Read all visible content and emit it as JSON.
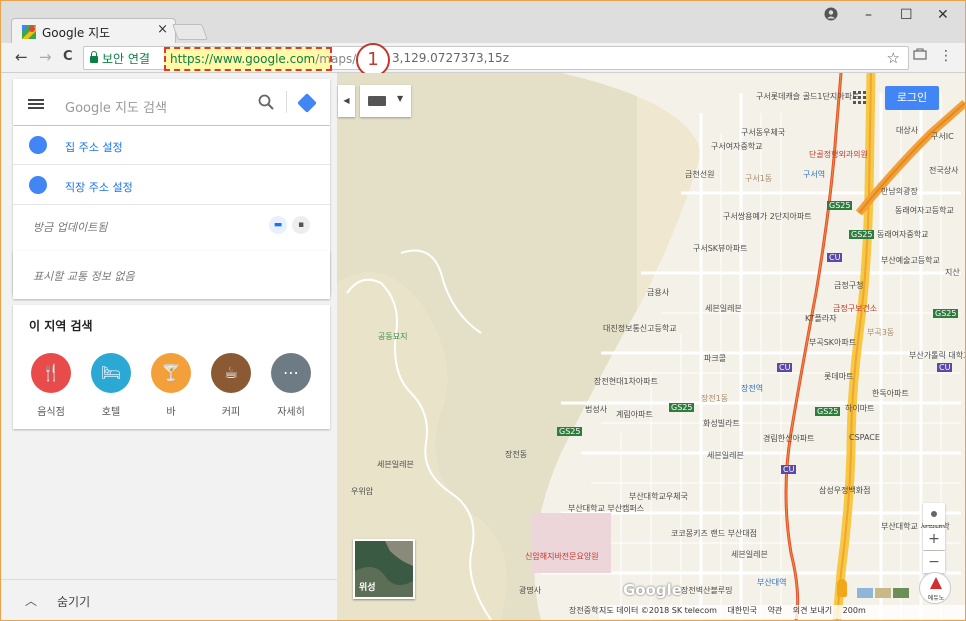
{
  "browser": {
    "tab_title": "Google 지도",
    "tab_close": "×",
    "secure_label": "보안 연결",
    "url_highlight_scheme": "https://www.google.com",
    "url_highlight_path": "/maps/",
    "url_rest": "3,129.0727373,15z",
    "callout_number": "1",
    "win_minimize": "–",
    "win_restore": "☐",
    "win_close": "✕",
    "star": "☆",
    "menu": "⋮",
    "back": "←",
    "forward": "→",
    "reload": "C"
  },
  "panel": {
    "search_placeholder": "Google 지도 검색",
    "home_label": "집 주소 설정",
    "work_label": "직장 주소 설정",
    "updated_label": "방금 업데이트됨",
    "traffic_label": "표시할 교통 정보 없음",
    "nearby_title": "이 지역 검색",
    "categories": [
      {
        "label": "음식점",
        "color": "#e94b4b",
        "icon": "🍴"
      },
      {
        "label": "호텔",
        "color": "#2ba8d3",
        "icon": "🛏"
      },
      {
        "label": "바",
        "color": "#f4a03a",
        "icon": "🍸"
      },
      {
        "label": "커피",
        "color": "#8b5a35",
        "icon": "☕"
      },
      {
        "label": "자세히",
        "color": "#6f7b84",
        "icon": "⋯"
      }
    ],
    "hide_label": "숨기기"
  },
  "map": {
    "login_label": "로그인",
    "satellite_label": "위성",
    "google_logo": "Google",
    "zoom_in": "+",
    "zoom_out": "−",
    "footer": {
      "data": "지도 데이터 ©2018 SK telecom",
      "country": "대한민국",
      "terms": "약관",
      "feedback": "의견 보내기",
      "scale": "200m"
    },
    "stamp_label": "에듀노",
    "labels": [
      {
        "t": "구서롯데캐슬 골드1단지아파트",
        "c": ""
      },
      {
        "t": "구서동우체국",
        "c": ""
      },
      {
        "t": "구서여자중학교",
        "c": ""
      },
      {
        "t": "단골정형외과의원",
        "c": "red"
      },
      {
        "t": "금천선원",
        "c": ""
      },
      {
        "t": "구서역",
        "c": "blue"
      },
      {
        "t": "구서쌍용예가 2단지아파트",
        "c": ""
      },
      {
        "t": "구서SK뷰아파트",
        "c": ""
      },
      {
        "t": "만남의광장",
        "c": ""
      },
      {
        "t": "동래여자고등학교",
        "c": ""
      },
      {
        "t": "동래여자중학교",
        "c": ""
      },
      {
        "t": "부산예술고등학교",
        "c": ""
      },
      {
        "t": "금정구청",
        "c": ""
      },
      {
        "t": "금정구보건소",
        "c": "red"
      },
      {
        "t": "KT플라자",
        "c": ""
      },
      {
        "t": "부곡SK아파트",
        "c": ""
      },
      {
        "t": "금용사",
        "c": ""
      },
      {
        "t": "세븐일레븐",
        "c": ""
      },
      {
        "t": "대진정보통신고등학교",
        "c": ""
      },
      {
        "t": "공동묘지",
        "c": "green"
      },
      {
        "t": "파크콜",
        "c": ""
      },
      {
        "t": "장전현대1차아파트",
        "c": ""
      },
      {
        "t": "장전역",
        "c": "blue"
      },
      {
        "t": "롯데마트",
        "c": ""
      },
      {
        "t": "부산가톨릭 대학교 지산캠퍼스",
        "c": ""
      },
      {
        "t": "한독아파트",
        "c": ""
      },
      {
        "t": "법성사",
        "c": ""
      },
      {
        "t": "계림아파트",
        "c": ""
      },
      {
        "t": "화성빌라트",
        "c": ""
      },
      {
        "t": "하이마트",
        "c": ""
      },
      {
        "t": "경림한신아파트",
        "c": ""
      },
      {
        "t": "CSPACE",
        "c": ""
      },
      {
        "t": "세븐일레븐",
        "c": ""
      },
      {
        "t": "장전동",
        "c": ""
      },
      {
        "t": "세븐일레븐",
        "c": ""
      },
      {
        "t": "우위암",
        "c": ""
      },
      {
        "t": "삼성우정백화점",
        "c": ""
      },
      {
        "t": "부산대학교 부산캠퍼스",
        "c": ""
      },
      {
        "t": "부산대학교우체국",
        "c": ""
      },
      {
        "t": "코코몽키즈 랜드 부산대점",
        "c": ""
      },
      {
        "t": "신암해지바전문요양원",
        "c": "red"
      },
      {
        "t": "세븐일레븐",
        "c": ""
      },
      {
        "t": "부산대역",
        "c": "blue"
      },
      {
        "t": "장전벽산블루밍",
        "c": ""
      },
      {
        "t": "광명사",
        "c": ""
      },
      {
        "t": "장전중학교",
        "c": ""
      },
      {
        "t": "부곡3동",
        "c": ""
      },
      {
        "t": "구서1동",
        "c": ""
      },
      {
        "t": "장전1동",
        "c": ""
      },
      {
        "t": "부산대학교 사범대학",
        "c": ""
      },
      {
        "t": "대상사",
        "c": ""
      },
      {
        "t": "구서IC",
        "c": ""
      },
      {
        "t": "전국상사",
        "c": ""
      },
      {
        "t": "지산",
        "c": ""
      }
    ],
    "hwy": [
      "GS25",
      "GS25",
      "GS25",
      "GS25",
      "GS25",
      "GS25",
      "CU",
      "CU",
      "CU",
      "CU"
    ]
  }
}
